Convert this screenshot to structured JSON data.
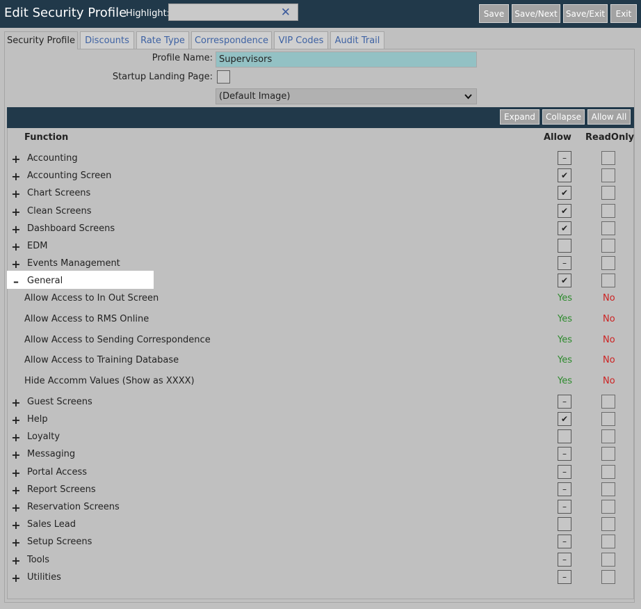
{
  "header": {
    "title": "Edit Security Profile",
    "highlight_label": "Highlight:",
    "highlight_value": "",
    "clear_icon": "✕",
    "buttons": [
      "Save",
      "Save/Next",
      "Save/Exit",
      "Exit"
    ]
  },
  "tabs": [
    "Security Profile",
    "Discounts",
    "Rate Type",
    "Correspondence",
    "VIP Codes",
    "Audit Trail"
  ],
  "form": {
    "profile_name_label": "Profile Name:",
    "profile_name_value": "Supervisors",
    "startup_label": "Startup Landing Page:",
    "image_select": "(Default Image)"
  },
  "grid": {
    "buttons": [
      "Expand",
      "Collapse",
      "Allow All"
    ],
    "columns": {
      "function": "Function",
      "allow": "Allow",
      "readonly": "ReadOnly"
    },
    "rows_top": [
      {
        "expander": "+",
        "name": "Accounting",
        "allow": "–",
        "readonly": ""
      },
      {
        "expander": "+",
        "name": "Accounting Screen",
        "allow": "✔",
        "readonly": ""
      },
      {
        "expander": "+",
        "name": "Chart Screens",
        "allow": "✔",
        "readonly": ""
      },
      {
        "expander": "+",
        "name": "Clean Screens",
        "allow": "✔",
        "readonly": ""
      },
      {
        "expander": "+",
        "name": "Dashboard Screens",
        "allow": "✔",
        "readonly": ""
      },
      {
        "expander": "+",
        "name": "EDM",
        "allow": "",
        "readonly": ""
      },
      {
        "expander": "+",
        "name": "Events Management",
        "allow": "–",
        "readonly": ""
      },
      {
        "expander": "–",
        "name": "General",
        "allow": "✔",
        "readonly": ""
      }
    ],
    "general_children": [
      {
        "name": "Allow Access to In Out Screen",
        "allow": "Yes",
        "readonly": "No"
      },
      {
        "name": "Allow Access to RMS Online",
        "allow": "Yes",
        "readonly": "No"
      },
      {
        "name": "Allow Access to Sending Correspondence",
        "allow": "Yes",
        "readonly": "No"
      },
      {
        "name": "Allow Access to Training Database",
        "allow": "Yes",
        "readonly": "No"
      },
      {
        "name": "Hide Accomm Values (Show as XXXX)",
        "allow": "Yes",
        "readonly": "No"
      }
    ],
    "rows_bottom": [
      {
        "expander": "+",
        "name": "Guest Screens",
        "allow": "–",
        "readonly": ""
      },
      {
        "expander": "+",
        "name": "Help",
        "allow": "✔",
        "readonly": ""
      },
      {
        "expander": "+",
        "name": "Loyalty",
        "allow": "",
        "readonly": ""
      },
      {
        "expander": "+",
        "name": "Messaging",
        "allow": "–",
        "readonly": ""
      },
      {
        "expander": "+",
        "name": "Portal Access",
        "allow": "–",
        "readonly": ""
      },
      {
        "expander": "+",
        "name": "Report Screens",
        "allow": "–",
        "readonly": ""
      },
      {
        "expander": "+",
        "name": "Reservation Screens",
        "allow": "–",
        "readonly": ""
      },
      {
        "expander": "+",
        "name": "Sales Lead",
        "allow": "",
        "readonly": ""
      },
      {
        "expander": "+",
        "name": "Setup Screens",
        "allow": "–",
        "readonly": ""
      },
      {
        "expander": "+",
        "name": "Tools",
        "allow": "–",
        "readonly": ""
      },
      {
        "expander": "+",
        "name": "Utilities",
        "allow": "–",
        "readonly": ""
      }
    ]
  }
}
